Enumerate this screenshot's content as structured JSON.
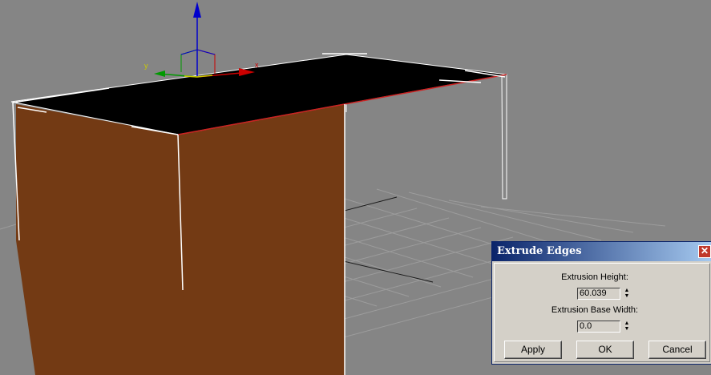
{
  "viewport": {
    "axis_labels": {
      "x": "x",
      "y": "y"
    },
    "colors": {
      "background": "#858585",
      "box_side": "#733a14",
      "box_top": "#000000",
      "selected_edge": "#cc2222",
      "grid": "#9a9a9a",
      "gizmo_x": "#cc0000",
      "gizmo_y": "#009900",
      "gizmo_z": "#0000cc"
    }
  },
  "dialog": {
    "title": "Extrude Edges",
    "close_glyph": "✕",
    "extrusion_height": {
      "label": "Extrusion Height:",
      "value": "60.039"
    },
    "extrusion_base_width": {
      "label": "Extrusion Base Width:",
      "value": "0.0"
    },
    "buttons": {
      "apply": "Apply",
      "ok": "OK",
      "cancel": "Cancel"
    }
  }
}
